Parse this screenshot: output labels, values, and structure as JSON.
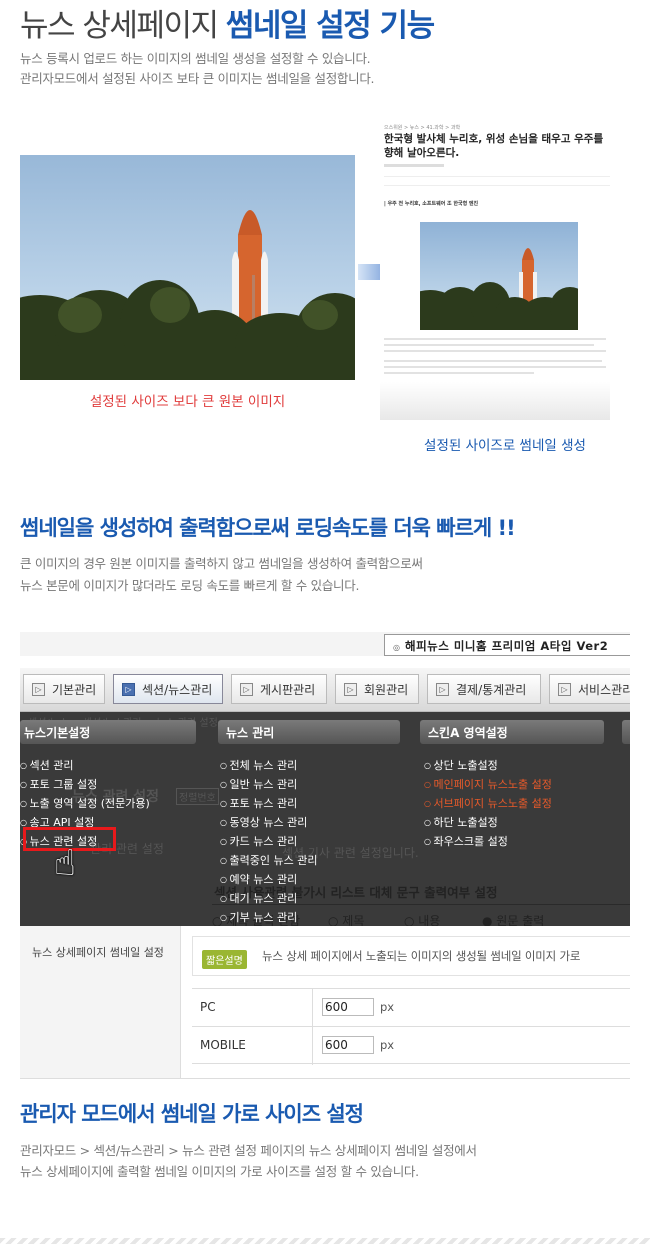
{
  "header": {
    "title_a": "뉴스 상세페이지",
    "title_b": "썸네일 설정 기능",
    "desc_lines": [
      "뉴스 등록시 업로드 하는 이미지의 썸네일 생성을 설정할 수 있습니다.",
      "관리자모드에서 설정된 사이즈 보타 큰 이미지는 썸네일을 설정합니다."
    ]
  },
  "demo": {
    "left_caption": "설정된 사이즈 보다 큰 원본 이미지",
    "right_caption": "설정된 사이즈로 썸네일 생성",
    "article_crumb": "으스위원 > 뉴스 > 41.과학 > 과학",
    "article_title": "한국형 발사체 누리호, 위성 손님을 태우고 우주를 향해 날아오른다.",
    "article_subhead": "| 우주 전 누리호, 소프트웨어 조 한국형 엔진"
  },
  "section2": {
    "title": "썸네일을 생성하여 출력함으로써 로딩속도를 더욱 빠르게 !!",
    "desc_lines": [
      "큰 이미지의 경우 원본 이미지를 출력하지 않고 썸네일을 생성하여 출력함으로써",
      "뉴스 본문에 이미지가 많더라도 로딩 속도를 빠르게 할 수 있습니다."
    ]
  },
  "admin": {
    "brand": "해피뉴스 미니홈 프리미엄 A타입 Ver2",
    "tabs": [
      "기본관리",
      "섹션/뉴스관리",
      "게시판관리",
      "회원관리",
      "결제/통계관리",
      "서비스관리"
    ],
    "columns": [
      {
        "title": "뉴스기본설정",
        "items": [
          "섹션 관리",
          "포토 그룹 설정",
          "노출 영역 설정 (전문가용)",
          "송고 API 설정",
          "뉴스 관련 설정"
        ]
      },
      {
        "title": "뉴스 관리",
        "items": [
          "전체 뉴스 관리",
          "일반 뉴스 관리",
          "포토 뉴스 관리",
          "동영상 뉴스 관리",
          "카드 뉴스 관리",
          "출력중인 뉴스 관리",
          "예약 뉴스 관리",
          "대기 뉴스 관리",
          "기부 뉴스 관리"
        ]
      },
      {
        "title": "스킨A 영역설정",
        "items": [
          "상단 노출설정",
          "메인페이지 뉴스노출 설정",
          "서브페이지 뉴스노출 설정",
          "하단 노출설정",
          "좌우스크롤 설정"
        ]
      }
    ],
    "ghost": {
      "crumb": "섹션/뉴스 > 섹션/뉴스관리 > 뉴스 관련 설정",
      "heading": "뉴스 관련 설정",
      "order": "정렬번호",
      "side": "관리 관련 설정",
      "intro": "섹션 기사 관련 설정입니다.",
      "bold_line": "섹션 사용관련 불가시 리스트 대체 문구 출력여부 설정",
      "radio_none": "제목 출력 안함",
      "radio_title": "제목",
      "radio_content": "내용",
      "radio_original": "원문 출력"
    },
    "settings": {
      "label": "뉴스 상세페이지 썸네일 설정",
      "badge": "짧은설명",
      "notice": "뉴스 상세 페이지에서 노출되는 이미지의 생성될 썸네일 이미지 가로",
      "rows": [
        {
          "label": "PC",
          "value": "600",
          "unit": "px"
        },
        {
          "label": "MOBILE",
          "value": "600",
          "unit": "px"
        }
      ]
    }
  },
  "section3": {
    "title": "관리자 모드에서 썸네일 가로 사이즈 설정",
    "desc_lines": [
      "관리자모드 > 섹션/뉴스관리 > 뉴스 관련 설정 페이지의 뉴스 상세페이지 썸네일 설정에서",
      "뉴스 상세페이지에 출력할 썸네일 이미지의 가로 사이즈를 설정 할 수 있습니다."
    ]
  }
}
